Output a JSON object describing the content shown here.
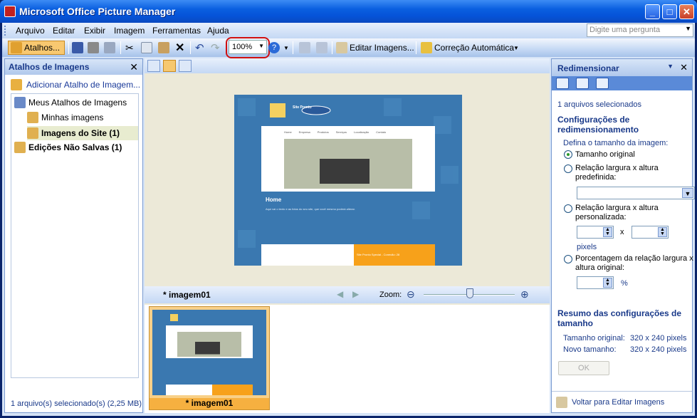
{
  "window": {
    "title": "Microsoft Office Picture Manager"
  },
  "menu": [
    "Arquivo",
    "Editar",
    "Exibir",
    "Imagem",
    "Ferramentas",
    "Ajuda"
  ],
  "ask": {
    "placeholder": "Digite uma pergunta"
  },
  "toolbar": {
    "shortcuts": "Atalhos...",
    "zoom": "100%",
    "edit_images": "Editar Imagens...",
    "auto_correct": "Correção Automática"
  },
  "left": {
    "header": "Atalhos de Imagens",
    "add_shortcut": "Adicionar Atalho de Imagem...",
    "tree": [
      "Meus Atalhos de Imagens",
      "Minhas imagens",
      "Imagens do Site (1)",
      "Edições Não Salvas (1)"
    ],
    "status": "1 arquivo(s) selecionado(s) (2,25 MB)"
  },
  "preview": {
    "image_name": "* imagem01",
    "zoom_label": "Zoom:",
    "zoom_level": 0.5,
    "site_title": "Site Pronto",
    "nav": [
      "Home",
      "Empresa",
      "Produtos",
      "Serviços",
      "Localização",
      "Contato"
    ],
    "section": "Home",
    "body": "Aqui vai o texto e as fotos do seu site, que você mesmo poderá alterar.",
    "footer": "Site Pronto Special - Conexão: 28"
  },
  "filmstrip": {
    "thumb_name": "* imagem01"
  },
  "right": {
    "header": "Redimensionar",
    "selected": "1 arquivos selecionados",
    "settings_title": "Configurações de redimensionamento",
    "define_size": "Defina o tamanho da imagem:",
    "opt_original": "Tamanho original",
    "opt_predefined_1": "Relação largura x altura",
    "opt_predefined_2": "predefinida:",
    "opt_custom_1": "Relação largura x altura",
    "opt_custom_2": "personalizada:",
    "times": "x",
    "pixels": "pixels",
    "opt_percent_1": "Porcentagem da relação largura x",
    "opt_percent_2": "altura original:",
    "percent_sign": "%",
    "summary_title": "Resumo das configurações de tamanho",
    "orig_label": "Tamanho original:",
    "orig_value": "320 x 240 pixels",
    "new_label": "Novo tamanho:",
    "new_value": "320 x 240 pixels",
    "ok": "OK",
    "back_link": "Voltar para Editar Imagens"
  },
  "colors": {
    "title_bar": "#0553d8",
    "accent": "#f6b040",
    "site_blue": "#3a78b0",
    "site_orange": "#f7a11a"
  }
}
